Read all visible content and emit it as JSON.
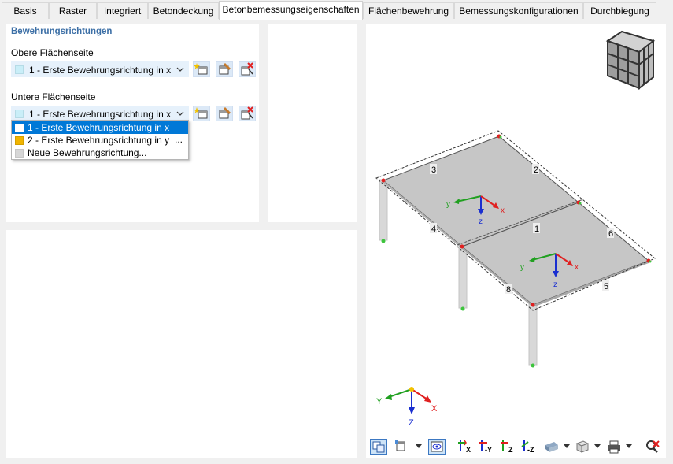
{
  "tabs": [
    {
      "label": "Basis",
      "active": false
    },
    {
      "label": "Raster",
      "active": false
    },
    {
      "label": "Integriert",
      "active": false
    },
    {
      "label": "Betondeckung",
      "active": false
    },
    {
      "label": "Betonbemessungseigenschaften",
      "active": true
    },
    {
      "label": "Flächenbewehrung",
      "active": false
    },
    {
      "label": "Bemessungskonfigurationen",
      "active": false
    },
    {
      "label": "Durchbiegung",
      "active": false
    }
  ],
  "reinforcement": {
    "section_title": "Bewehrungsrichtungen",
    "upper": {
      "label": "Obere Flächenseite",
      "selected": "1 - Erste Bewehrungsrichtung in x"
    },
    "lower": {
      "label": "Untere Flächenseite",
      "selected": "1 - Erste Bewehrungsrichtung in x"
    },
    "options": [
      {
        "label": "1 - Erste Bewehrungsrichtung in x",
        "color": "#c9eef8",
        "selected": true
      },
      {
        "label": "2 - Erste Bewehrungsrichtung in y",
        "color": "#f0b400",
        "selected": false
      },
      {
        "label": "Neue Bewehrungsrichtung...",
        "color": "#d6d6d6",
        "selected": false
      }
    ],
    "more_label": "..."
  },
  "model": {
    "edge_labels": [
      "1",
      "2",
      "3",
      "4",
      "5",
      "6",
      "8"
    ],
    "local_axes": {
      "x": "x",
      "y": "y",
      "z": "z"
    },
    "global_axes": {
      "x": "X",
      "y": "Y",
      "z": "Z"
    }
  },
  "colors": {
    "accent": "#3c6fa6",
    "selection": "#0078d7",
    "axis_x": "#e02020",
    "axis_y": "#20a020",
    "axis_z": "#1a2fd0"
  },
  "viewport_toolbar": {
    "icons": [
      "view-select-icon",
      "display-options-icon",
      "visibility-icon",
      "view-x-icon",
      "view-minus-y-icon",
      "view-z-icon",
      "view-minus-z-icon",
      "render-mode-icon",
      "iso-view-icon",
      "print-icon",
      "reset-view-icon"
    ],
    "labels": {
      "x": "X",
      "minus_y": "-Y",
      "z": "Z",
      "minus_z": "-Z"
    }
  }
}
